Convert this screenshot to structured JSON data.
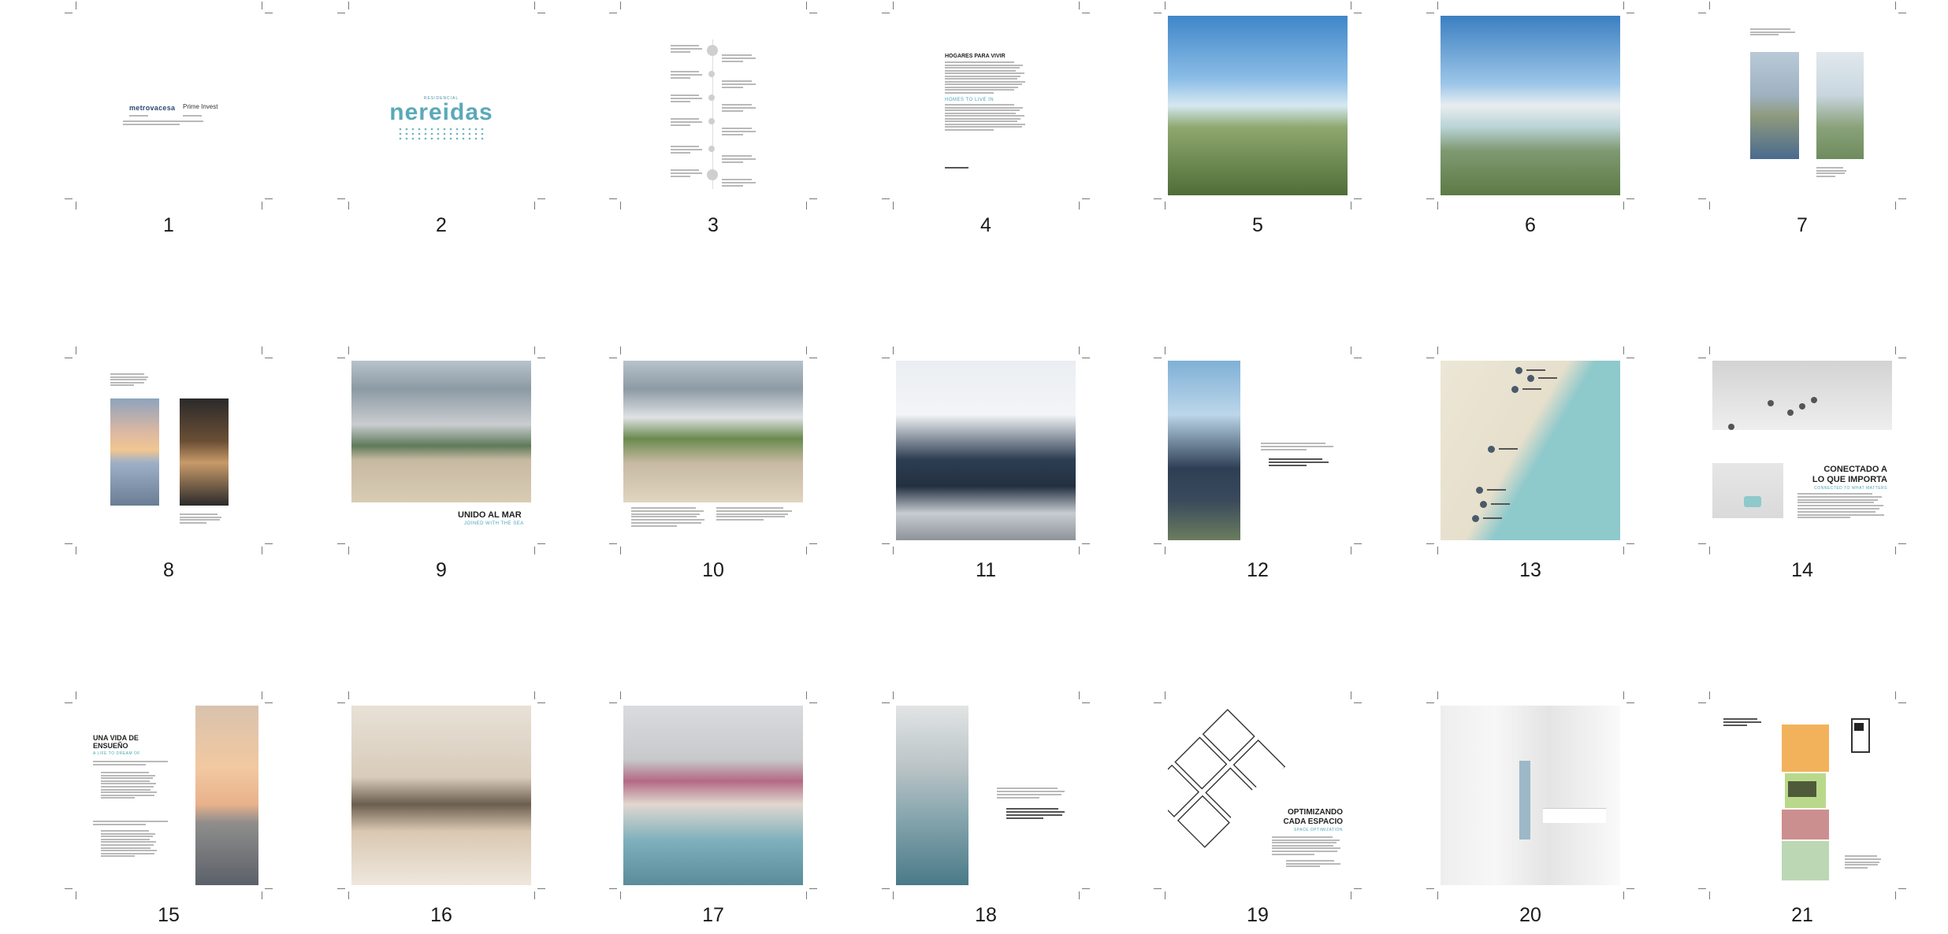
{
  "pages": [
    {
      "number": "1"
    },
    {
      "number": "2"
    },
    {
      "number": "3"
    },
    {
      "number": "4"
    },
    {
      "number": "5"
    },
    {
      "number": "6"
    },
    {
      "number": "7"
    },
    {
      "number": "8"
    },
    {
      "number": "9"
    },
    {
      "number": "10"
    },
    {
      "number": "11"
    },
    {
      "number": "12"
    },
    {
      "number": "13"
    },
    {
      "number": "14"
    },
    {
      "number": "15"
    },
    {
      "number": "16"
    },
    {
      "number": "17"
    },
    {
      "number": "18"
    },
    {
      "number": "19"
    },
    {
      "number": "20"
    },
    {
      "number": "21"
    }
  ],
  "page1": {
    "logo_left": "metrovacesa",
    "logo_right": "Prime Invest"
  },
  "page2": {
    "small_text": "RESIDENCIAL",
    "title": "nereidas"
  },
  "page4": {
    "heading": "HOGARES PARA VIVIR",
    "subheading": "HOMES TO LIVE IN"
  },
  "page9": {
    "heading": "UNIDO AL MAR",
    "subheading": "JOINED WITH THE SEA"
  },
  "page14": {
    "heading_line1": "CONECTADO A",
    "heading_line2": "LO QUE IMPORTA",
    "subheading": "CONNECTED TO WHAT MATTERS"
  },
  "page15": {
    "heading_line1": "UNA VIDA DE",
    "heading_line2": "ENSUEÑO",
    "subheading": "A LIFE TO DREAM OF"
  },
  "page19": {
    "heading_line1": "OPTIMIZANDO",
    "heading_line2": "CADA ESPACIO",
    "subheading": "SPACE OPTIMIZATION"
  },
  "colors": {
    "accent": "#5aa9b8",
    "sea": "#8ec9cc",
    "map_land": "#ece6d6"
  }
}
